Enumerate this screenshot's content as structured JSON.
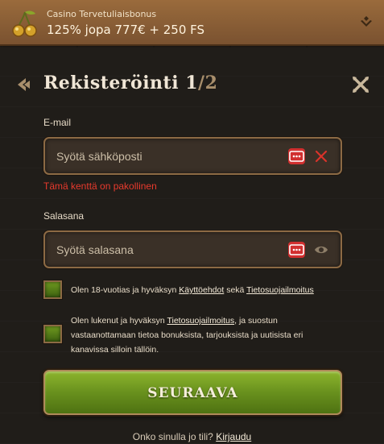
{
  "bonus": {
    "subtitle": "Casino Tervetuliaisbonus",
    "offer": "125% jopa 777€ + 250 FS"
  },
  "header": {
    "title": "Rekisteröinti 1",
    "step_total": "/2"
  },
  "email": {
    "label": "E-mail",
    "placeholder": "Syötä sähköposti",
    "value": "",
    "error": "Tämä kenttä on pakollinen"
  },
  "password": {
    "label": "Salasana",
    "placeholder": "Syötä salasana",
    "value": ""
  },
  "consents": [
    {
      "checked": true,
      "text_before": "Olen 18-vuotias ja hyväksyn ",
      "link1": "Käyttöehdot",
      "text_middle": " sekä ",
      "link2": "Tietosuojailmoitus"
    },
    {
      "checked": true,
      "text_before": "Olen lukenut ja hyväksyn ",
      "link1": "Tietosuojailmoitus",
      "text_after": ", ja suostun vastaanottamaan tietoa bonuksista, tarjouksista ja uutisista eri kanavissa silloin tällöin."
    }
  ],
  "submit_label": "SEURAAVA",
  "footer": {
    "question": "Onko sinulla jo tili?",
    "login_link": "Kirjaudu"
  },
  "icons": {
    "bonus": "cherry-icon",
    "expand": "chevron-down-icon",
    "back": "arrow-left-icon",
    "close": "close-icon",
    "password_manager": "password-manager-icon",
    "clear": "clear-icon",
    "reveal": "eye-icon"
  },
  "colors": {
    "accent_green": "#6f9a1f",
    "error": "#e83a2d",
    "frame": "#8c6a44",
    "bonus_bar": "#9a6b3c"
  }
}
